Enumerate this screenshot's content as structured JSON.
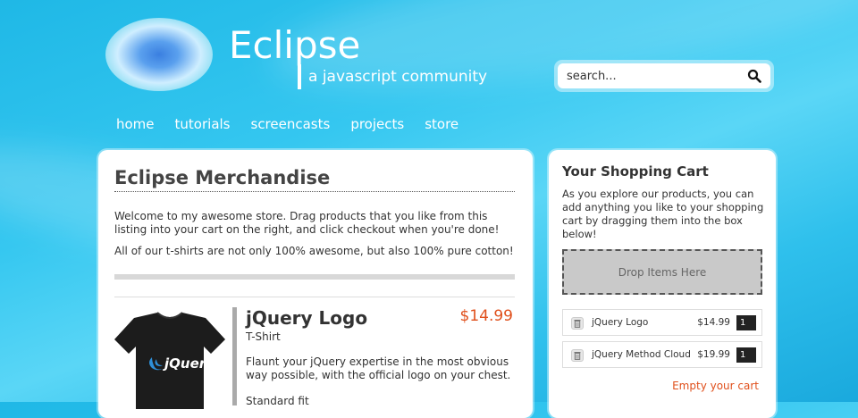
{
  "header": {
    "title": "Eclipse",
    "tagline": "a javascript community",
    "search": {
      "placeholder": "search..."
    }
  },
  "nav": {
    "items": [
      "home",
      "tutorials",
      "screencasts",
      "projects",
      "store"
    ]
  },
  "main": {
    "title": "Eclipse Merchandise",
    "intro": "Welcome to my awesome store. Drag products that you like from this listing into your cart on the right, and click checkout when you're done!",
    "intro2": "All of our t-shirts are not only 100% awesome, but also 100% pure cotton!",
    "product": {
      "name": "jQuery Logo",
      "type": "T-Shirt",
      "price": "$14.99",
      "description": "Flaunt your jQuery expertise in the most obvious way possible, with the official logo on your chest.",
      "fit": "Standard fit",
      "shirt_text": "jQuery"
    }
  },
  "cart": {
    "title": "Your Shopping Cart",
    "description": "As you explore our products, you can add anything you like to your shopping cart by dragging them into the box below!",
    "drop_label": "Drop Items Here",
    "items": [
      {
        "name": "jQuery Logo",
        "price": "$14.99",
        "qty": "1"
      },
      {
        "name": "jQuery Method Cloud",
        "price": "$19.99",
        "qty": "1"
      }
    ],
    "empty_label": "Empty your cart"
  },
  "colors": {
    "accent": "#e0501c",
    "sky": "#35c7f0"
  }
}
